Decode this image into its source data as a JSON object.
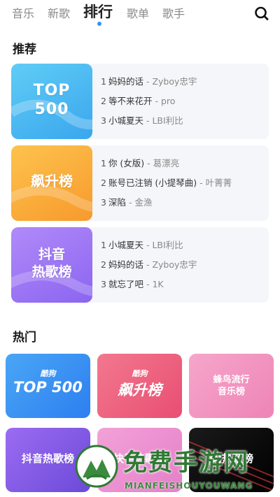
{
  "nav": {
    "tabs": [
      {
        "label": "音乐"
      },
      {
        "label": "新歌"
      },
      {
        "label": "排行"
      },
      {
        "label": "歌单"
      },
      {
        "label": "歌手"
      }
    ],
    "active_tab": "排行",
    "search_icon": "search-icon"
  },
  "recommend": {
    "title": "推荐",
    "charts": [
      {
        "cover_text": "TOP\n500",
        "cover_colors": [
          "#5fcdf6",
          "#3aa6ee"
        ],
        "songs": [
          {
            "num": "1",
            "name": "妈妈的话",
            "artist": "Zyboy忠宇"
          },
          {
            "num": "2",
            "name": "等不来花开",
            "artist": "pro"
          },
          {
            "num": "3",
            "name": "小城夏天",
            "artist": "LBI利比"
          }
        ]
      },
      {
        "cover_text": "飙升榜",
        "cover_colors": [
          "#fdc34d",
          "#f79a2d"
        ],
        "songs": [
          {
            "num": "1",
            "name": "你 (女版)",
            "artist": "葛漂亮"
          },
          {
            "num": "2",
            "name": "账号已注销 (小提琴曲)",
            "artist": "叶菁菁"
          },
          {
            "num": "3",
            "name": "深陷",
            "artist": "金渔"
          }
        ]
      },
      {
        "cover_text": "抖音\n热歌榜",
        "cover_colors": [
          "#b18af9",
          "#8b65f0"
        ],
        "songs": [
          {
            "num": "1",
            "name": "小城夏天",
            "artist": "LBI利比"
          },
          {
            "num": "2",
            "name": "妈妈的话",
            "artist": "Zyboy忠宇"
          },
          {
            "num": "3",
            "name": "就忘了吧",
            "artist": "1K"
          }
        ]
      }
    ]
  },
  "hot": {
    "title": "热门",
    "tiles": [
      {
        "brand": "酷狗",
        "label": "TOP 500",
        "colors": [
          "#4aa6f5",
          "#2d7ff0"
        ]
      },
      {
        "brand": "酷狗",
        "label": "飙升榜",
        "colors": [
          "#f2788e",
          "#e94e72"
        ]
      },
      {
        "brand": "",
        "label": "蜂鸟流行\n音乐榜",
        "colors": [
          "#f6a6cb",
          "#ee84b6"
        ]
      },
      {
        "brand": "",
        "label": "抖音热歌榜",
        "colors": [
          "#9c6cf2",
          "#6b4ad8"
        ]
      },
      {
        "brand": "",
        "label": "快手热歌榜",
        "colors": [
          "#f2a2d8",
          "#e57fc9"
        ]
      },
      {
        "brand": "",
        "label": "DJ热歌榜",
        "colors": [
          "#1a1a1a",
          "#000000"
        ]
      }
    ]
  },
  "watermark": {
    "cn": "免费手游网",
    "en": "MIANFEISHOUYOUWANG"
  }
}
